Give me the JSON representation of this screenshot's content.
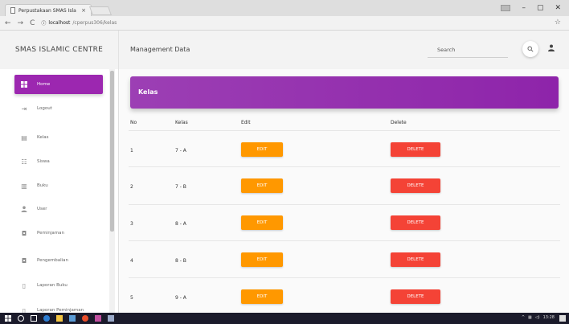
{
  "browser": {
    "tab_title": "Perpustakaan SMAS Isla",
    "tab_close": "×",
    "url_host": "localhost",
    "url_path": "/cperpus306/kelas",
    "controls": [
      "–",
      "▢",
      "✕"
    ]
  },
  "app": {
    "brand": "SMAS ISLAMIC CENTRE",
    "page_title": "Management Data",
    "search_label": "Search",
    "search_icon": "search-icon",
    "user_icon": "person-icon",
    "accent_color": "#9c27b0"
  },
  "sidebar": {
    "items": [
      {
        "label": "Home",
        "icon": "dashboard-icon",
        "active": true
      },
      {
        "label": "Logout",
        "icon": "logout-icon",
        "active": false
      },
      {
        "label": "Kelas",
        "icon": "class-icon",
        "active": false
      },
      {
        "label": "Siswa",
        "icon": "people-icon",
        "active": false
      },
      {
        "label": "Buku",
        "icon": "book-icon",
        "active": false
      },
      {
        "label": "User",
        "icon": "user-icon",
        "active": false
      },
      {
        "label": "Peminjaman",
        "icon": "loan-icon",
        "active": false
      },
      {
        "label": "Pengembalian",
        "icon": "return-icon",
        "active": false
      },
      {
        "label": "Laporan Buku",
        "icon": "report-icon",
        "active": false
      },
      {
        "label": "Laporan Peminjaman",
        "icon": "report-icon",
        "active": false
      }
    ]
  },
  "card": {
    "title": "Kelas"
  },
  "table": {
    "headers": [
      "No",
      "Kelas",
      "Edit",
      "Delete"
    ],
    "rows": [
      {
        "no": "1",
        "kelas": "7 - A",
        "edit": "EDIT",
        "delete": "DELETE"
      },
      {
        "no": "2",
        "kelas": "7 - B",
        "edit": "EDIT",
        "delete": "DELETE"
      },
      {
        "no": "3",
        "kelas": "8 - A",
        "edit": "EDIT",
        "delete": "DELETE"
      },
      {
        "no": "4",
        "kelas": "8 - B",
        "edit": "EDIT",
        "delete": "DELETE"
      },
      {
        "no": "5",
        "kelas": "9 - A",
        "edit": "EDIT",
        "delete": "DELETE"
      }
    ],
    "edit_color": "#ff9800",
    "delete_color": "#f44336"
  },
  "taskbar": {
    "clock": "13:28"
  }
}
